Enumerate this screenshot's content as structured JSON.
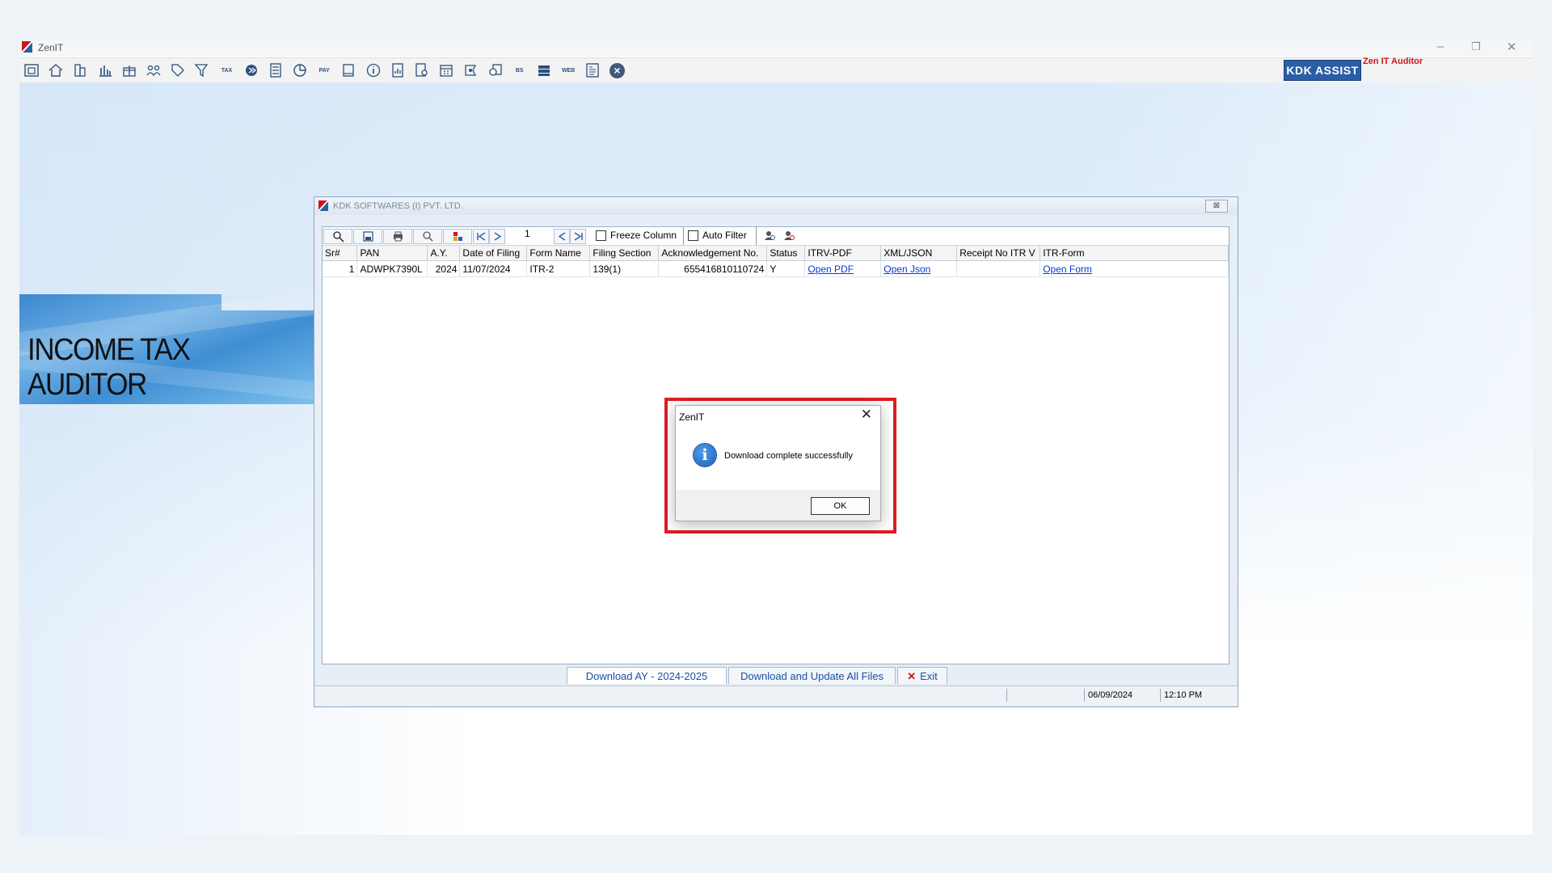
{
  "app": {
    "title": "ZenIT",
    "kdk_assist_label": "KDK ASSIST",
    "zen_label": "Zen IT Auditor",
    "toolbar_icons": [
      "file-icon",
      "home-icon",
      "building-icon",
      "bar-chart-icon",
      "gift-icon",
      "people-icon",
      "tag-icon",
      "filter-icon",
      "tax-icon",
      "arrows-icon",
      "calculator-icon",
      "pie-chart-icon",
      "pay-icon",
      "book-icon",
      "info-icon",
      "report-icon",
      "search-doc-icon",
      "calendar-icon",
      "stamp-icon",
      "copy-icon",
      "bs-icon",
      "stack-icon",
      "web-icon",
      "doc-icon",
      "close-icon"
    ],
    "tool_labels": {
      "tax": "TAX",
      "pay": "PAY",
      "bs": "BS",
      "web": "WEB"
    }
  },
  "banner": {
    "text": "INCOME TAX AUDITOR"
  },
  "inner_window": {
    "title": "KDK SOFTWARES (I) PVT. LTD.",
    "page_number": "1",
    "freeze_column_label": "Freeze Column",
    "auto_filter_label": "Auto Filter",
    "columns": [
      "Sr#",
      "PAN",
      "A.Y.",
      "Date of Filing",
      "Form Name",
      "Filing Section",
      "Acknowledgement No.",
      "Status",
      "ITRV-PDF",
      "XML/JSON",
      "Receipt No ITR V",
      "ITR-Form"
    ],
    "rows": [
      {
        "sr": "1",
        "pan": "ADWPK7390L",
        "ay": "2024",
        "date": "11/07/2024",
        "form": "ITR-2",
        "section": "139(1)",
        "ack": "655416810110724",
        "status": "Y",
        "itrv": "Open PDF",
        "xml": "Open Json",
        "receipt": "",
        "itr_form": "Open Form"
      }
    ],
    "tabs": {
      "download_ay": "Download AY - 2024-2025",
      "download_all": "Download and Update All Files",
      "exit": "Exit"
    },
    "status": {
      "date": "06/09/2024",
      "time": "12:10 PM"
    }
  },
  "dialog": {
    "title": "ZenIT",
    "message": "Download complete successfully",
    "ok_label": "OK",
    "info_glyph": "i",
    "highlight_color": "#e01b24"
  },
  "colors": {
    "accent": "#2b5ea6",
    "link": "#0a3bd6",
    "brand_red": "#d0151b"
  }
}
